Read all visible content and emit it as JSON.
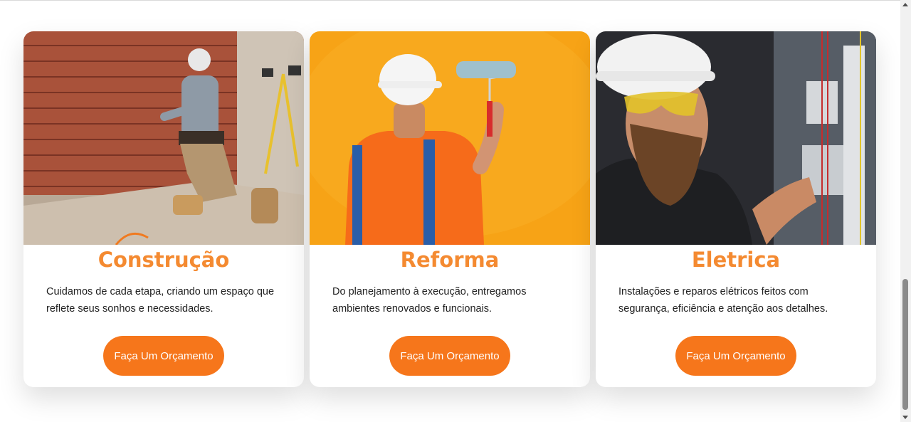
{
  "colors": {
    "accent": "#f48a31",
    "button_bg": "#f6761b",
    "button_text": "#ffffff",
    "text": "#222222"
  },
  "cards": [
    {
      "image_name": "construction-worker-photo",
      "title": "Construção",
      "description": "Cuidamos de cada etapa, criando um espaço que reflete seus sonhos e necessidades.",
      "button_label": "Faça Um Orçamento"
    },
    {
      "image_name": "painter-with-roller-photo",
      "title": "Reforma",
      "description": "Do planejamento à execução, entregamos ambientes renovados e funcionais.",
      "button_label": "Faça Um Orçamento"
    },
    {
      "image_name": "electrician-at-panel-photo",
      "title": "Eletrica",
      "description": "Instalações e reparos elétricos feitos com segurança, eficiência e atenção aos detalhes.",
      "button_label": "Faça Um Orçamento"
    }
  ]
}
